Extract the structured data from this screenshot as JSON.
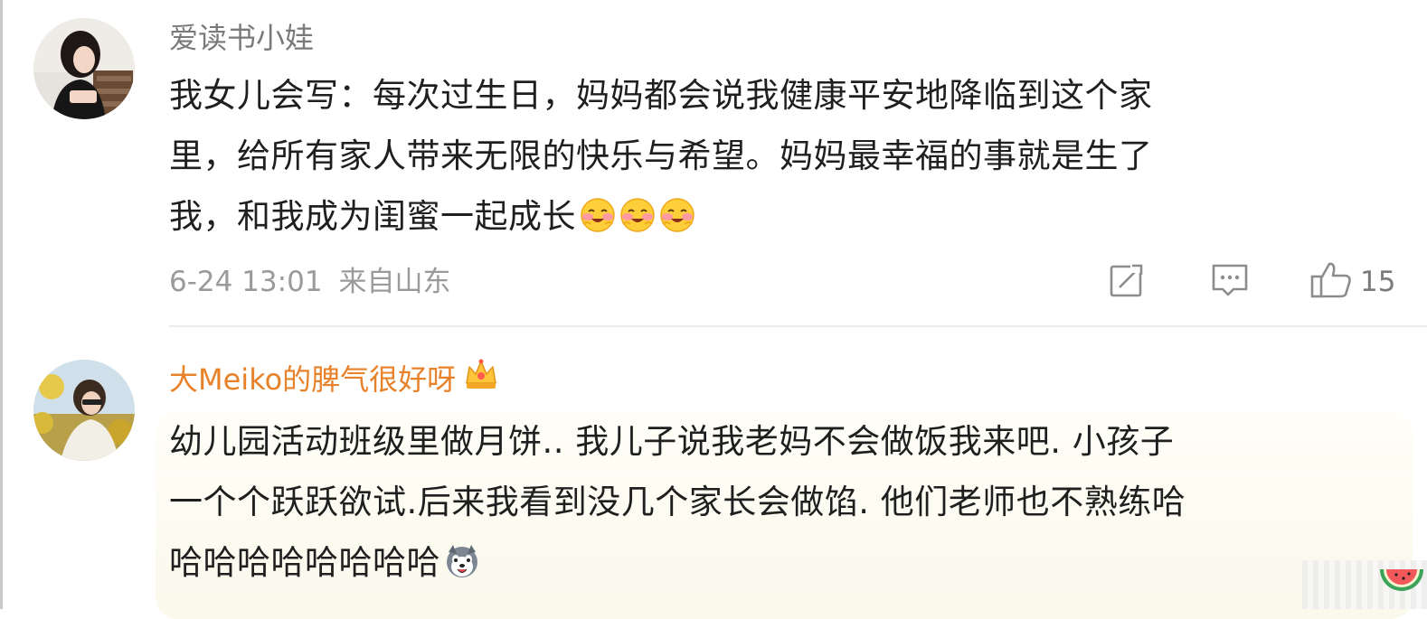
{
  "comments": [
    {
      "username": "爱读书小娃",
      "body_lines": [
        "我女儿会写：每次过生日，妈妈都会说我健康平安地降临到这个家",
        "里，给所有家人带来无限的快乐与希望。妈妈最幸福的事就是生了",
        "我，和我成为闺蜜一起成长"
      ],
      "emoji": "blush-emoji",
      "timestamp": "6-24 13:01",
      "location": "来自山东",
      "like_count": "15",
      "icons": {
        "share": "share-icon",
        "reply": "comment-icon",
        "like": "thumbs-up-icon"
      }
    },
    {
      "username": "大Meiko的脾气很好呀",
      "badge": "crown-icon",
      "body_lines": [
        "幼儿园活动班级里做月饼.. 我儿子说我老妈不会做饭我来吧. 小孩子",
        "一个个跃跃欲试.后来我看到没几个家长会做馅. 他们老师也不熟练哈",
        "哈哈哈哈哈哈哈哈"
      ],
      "emoji": "husky-emoji"
    }
  ],
  "colors": {
    "username_default": "#7a7a7a",
    "username_vip": "#e8822a",
    "body_text": "#1f1f1f",
    "meta_text": "#9a9a9a",
    "divider": "#ececec"
  }
}
